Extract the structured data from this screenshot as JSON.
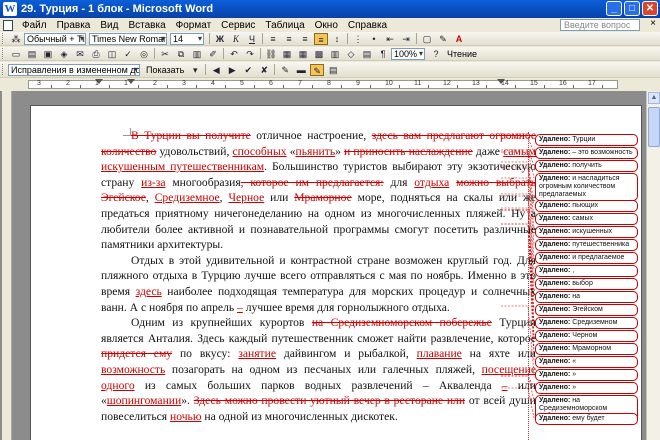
{
  "window": {
    "title": "29. Турция - 1 блок - Microsoft Word",
    "app_icon_letter": "W",
    "minimize": "_",
    "maximize": "□",
    "close": "✕"
  },
  "menu": {
    "items": [
      "Файл",
      "Правка",
      "Вид",
      "Вставка",
      "Формат",
      "Сервис",
      "Таблица",
      "Окно",
      "Справка"
    ],
    "help_placeholder": "Введите вопрос",
    "close_doc": "×"
  },
  "format_toolbar": {
    "style": "Обычный + Tim",
    "font": "Times New Roman",
    "size": "14",
    "bold": "Ж",
    "italic": "К",
    "underline": "Ч",
    "font_color_letter": "A"
  },
  "standard_toolbar": {
    "zoom": "100%",
    "reading": "Чтение"
  },
  "review_toolbar": {
    "display_mode": "Исправления в измененном документе",
    "show_label": "Показать"
  },
  "ruler": {
    "numbers": [
      "3",
      "2",
      "1",
      "1",
      "2",
      "3",
      "4",
      "5",
      "6",
      "7",
      "8",
      "9",
      "10",
      "11",
      "12",
      "13",
      "14",
      "15",
      "16",
      "17"
    ]
  },
  "document": {
    "paragraphs": [
      [
        {
          "t": "В Турции вы получите",
          "s": "del"
        },
        {
          "t": " отличное настроение, ",
          "s": ""
        },
        {
          "t": "здесь вам предлагают огромное количество",
          "s": "del"
        },
        {
          "t": " удовольствий, ",
          "s": ""
        },
        {
          "t": "способных",
          "s": "ins"
        },
        {
          "t": " «",
          "s": ""
        },
        {
          "t": "пьянить",
          "s": "ins"
        },
        {
          "t": "» ",
          "s": ""
        },
        {
          "t": "и приносить наслаждение",
          "s": "del"
        },
        {
          "t": " даже ",
          "s": ""
        },
        {
          "t": "самым искушенным путешественникам",
          "s": "ins"
        },
        {
          "t": ". Большинство туристов выбирают эту экзотическую страну ",
          "s": ""
        },
        {
          "t": "из-за",
          "s": "ins"
        },
        {
          "t": " многообразия",
          "s": ""
        },
        {
          "t": ", которое им предлагается:",
          "s": "del"
        },
        {
          "t": " для ",
          "s": ""
        },
        {
          "t": "отдыха",
          "s": "ins"
        },
        {
          "t": " ",
          "s": ""
        },
        {
          "t": "можно выбрать Эгейское",
          "s": "del"
        },
        {
          "t": ", ",
          "s": ""
        },
        {
          "t": "Средиземное",
          "s": "ins"
        },
        {
          "t": ", ",
          "s": ""
        },
        {
          "t": "Черное",
          "s": "ins"
        },
        {
          "t": " или ",
          "s": ""
        },
        {
          "t": "Мраморное",
          "s": "del"
        },
        {
          "t": " море, подняться на скалы или же предаться приятному ничегонеделанию на одном из многочисленных пляжей. Ну а любители более активной и познавательной программы смогут посетить различные памятники архитектуры.",
          "s": ""
        }
      ],
      [
        {
          "t": "Отдых в этой удивительной и контрастной стране возможен круглый год. Для пляжного отдыха в Турцию лучше всего отправляться с мая по ноябрь. Именно в это время ",
          "s": ""
        },
        {
          "t": "здесь",
          "s": "ins"
        },
        {
          "t": " наиболее подходящая температура для морских процедур и солнечных ванн. А с ноября по апрель ",
          "s": ""
        },
        {
          "t": "–",
          "s": "ins"
        },
        {
          "t": " лучшее время для горнолыжного отдыха.",
          "s": ""
        }
      ],
      [
        {
          "t": "Одним из крупнейших курортов ",
          "s": ""
        },
        {
          "t": "на Средиземноморском побережье",
          "s": "del"
        },
        {
          "t": " Турции является Анталия. Здесь каждый путешественник сможет найти развлечение, которое ",
          "s": ""
        },
        {
          "t": "придется ему",
          "s": "del"
        },
        {
          "t": " по вкусу: ",
          "s": ""
        },
        {
          "t": "занятие",
          "s": "ins"
        },
        {
          "t": " дайвингом и рыбалкой, ",
          "s": ""
        },
        {
          "t": "плавание",
          "s": "ins"
        },
        {
          "t": " на яхте или ",
          "s": ""
        },
        {
          "t": "возможность",
          "s": "ins"
        },
        {
          "t": " позагорать на одном из песчаных или галечных пляжей, ",
          "s": ""
        },
        {
          "t": "посещение одного",
          "s": "ins"
        },
        {
          "t": " из самых больших парков водных развлечений – Аквалендa ",
          "s": ""
        },
        {
          "t": "–",
          "s": "ins"
        },
        {
          "t": " или «",
          "s": ""
        },
        {
          "t": "шопингомании",
          "s": "ins"
        },
        {
          "t": "». ",
          "s": ""
        },
        {
          "t": "Здесь можно провести уютный вечер в ресторане или",
          "s": "del"
        },
        {
          "t": " от всей души повеселиться ",
          "s": ""
        },
        {
          "t": "ночью",
          "s": "ins"
        },
        {
          "t": " на одной из многочисленных дискотек.",
          "s": ""
        }
      ]
    ]
  },
  "balloons": {
    "label": "Удалено:",
    "items": [
      "Турции",
      "– это возможность",
      "получить",
      "и насладиться огромным количеством предлагаемых",
      "пьющих",
      "самых",
      "искушенных",
      "путешественника",
      "и предлагаемое",
      ",",
      "выбор",
      "на",
      "Эгейском",
      "Средиземном",
      "Черном",
      "Мраморном",
      "«",
      "»",
      "»",
      "на Средиземноморском побережье",
      "ему будет"
    ]
  }
}
